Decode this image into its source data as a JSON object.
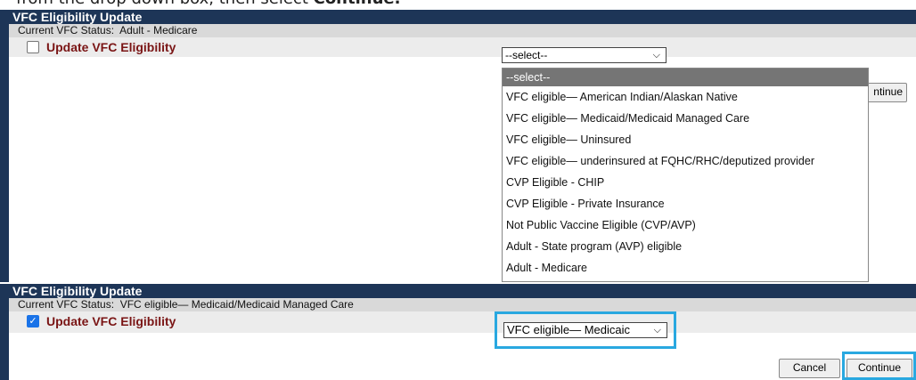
{
  "caption": {
    "text_before": "from the drop down box, then select ",
    "text_bold": "Continue."
  },
  "top_panel": {
    "title": "VFC Eligibility Update",
    "status_label": "Current VFC Status:",
    "status_value": "Adult - Medicare",
    "update_label": "Update VFC Eligibility",
    "update_checked": false,
    "select_value": "--select--",
    "continue_partial": "ntinue",
    "dropdown_options": [
      "--select--",
      "VFC eligible— American Indian/Alaskan Native",
      "VFC eligible— Medicaid/Medicaid Managed Care",
      "VFC eligible— Uninsured",
      "VFC eligible— underinsured at FQHC/RHC/deputized provider",
      "CVP Eligible - CHIP",
      "CVP Eligible - Private Insurance",
      "Not Public Vaccine Eligible (CVP/AVP)",
      "Adult - State program (AVP) eligible",
      "Adult - Medicare"
    ]
  },
  "bottom_panel": {
    "title": "VFC Eligibility Update",
    "status_label": "Current VFC Status:",
    "status_value": "VFC eligible— Medicaid/Medicaid Managed Care",
    "update_label": "Update VFC Eligibility",
    "update_checked": true,
    "select_value": "VFC eligible— Medicaic",
    "cancel_label": "Cancel",
    "continue_label": "Continue"
  },
  "colors": {
    "panel_border": "#1d3557",
    "label_red": "#7a1515",
    "highlight": "#29a8e0"
  }
}
